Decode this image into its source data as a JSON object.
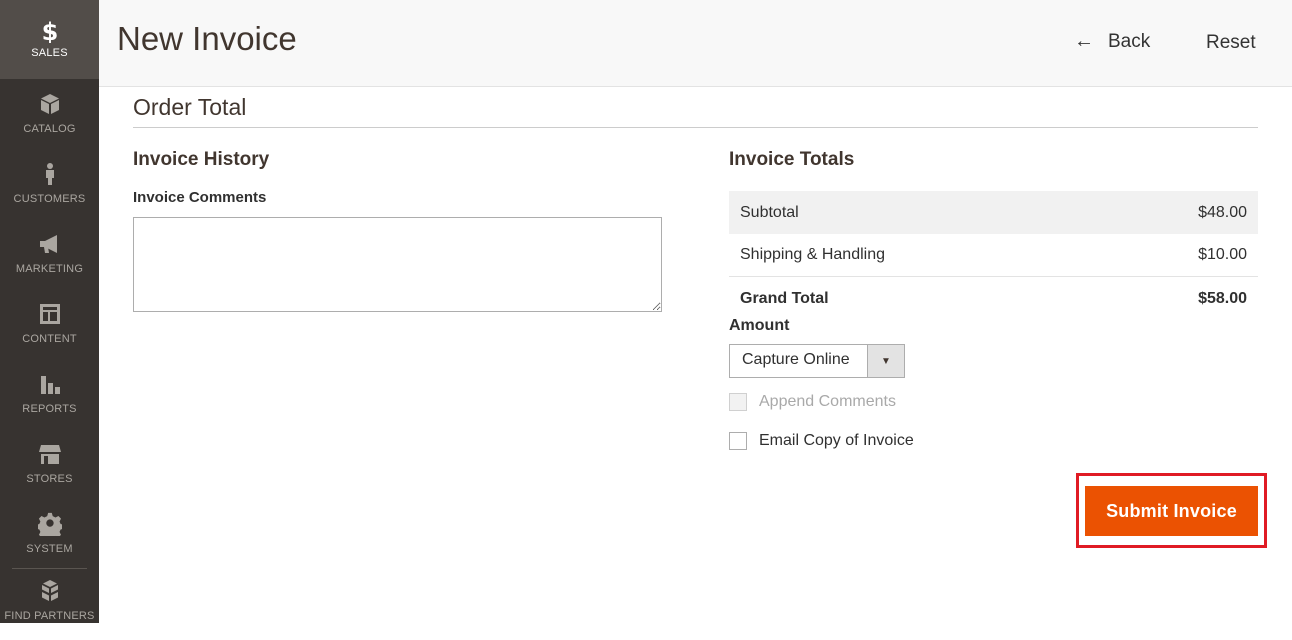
{
  "sidebar": {
    "items": [
      {
        "label": "SALES",
        "icon": "dollar-icon"
      },
      {
        "label": "CATALOG",
        "icon": "box-icon"
      },
      {
        "label": "CUSTOMERS",
        "icon": "person-icon"
      },
      {
        "label": "MARKETING",
        "icon": "megaphone-icon"
      },
      {
        "label": "CONTENT",
        "icon": "layout-icon"
      },
      {
        "label": "REPORTS",
        "icon": "bar-chart-icon"
      },
      {
        "label": "STORES",
        "icon": "storefront-icon"
      },
      {
        "label": "SYSTEM",
        "icon": "gear-icon"
      },
      {
        "label": "FIND PARTNERS",
        "icon": "cubes-icon"
      }
    ]
  },
  "header": {
    "title": "New Invoice",
    "back_label": "Back",
    "reset_label": "Reset"
  },
  "order_total": {
    "title": "Order Total",
    "history": {
      "title": "Invoice History",
      "comments_label": "Invoice Comments",
      "comments_value": ""
    },
    "totals": {
      "title": "Invoice Totals",
      "rows": [
        {
          "label": "Subtotal",
          "value": "$48.00"
        },
        {
          "label": "Shipping & Handling",
          "value": "$10.00"
        },
        {
          "label": "Grand Total",
          "value": "$58.00"
        }
      ],
      "amount_label": "Amount",
      "amount_selected": "Capture Online",
      "append_comments_label": "Append Comments",
      "email_copy_label": "Email Copy of Invoice",
      "submit_label": "Submit Invoice"
    }
  },
  "colors": {
    "sidebar_bg": "#373330",
    "sidebar_active_bg": "#524d49",
    "accent": "#eb5202",
    "highlight_outline": "#e01b24"
  }
}
